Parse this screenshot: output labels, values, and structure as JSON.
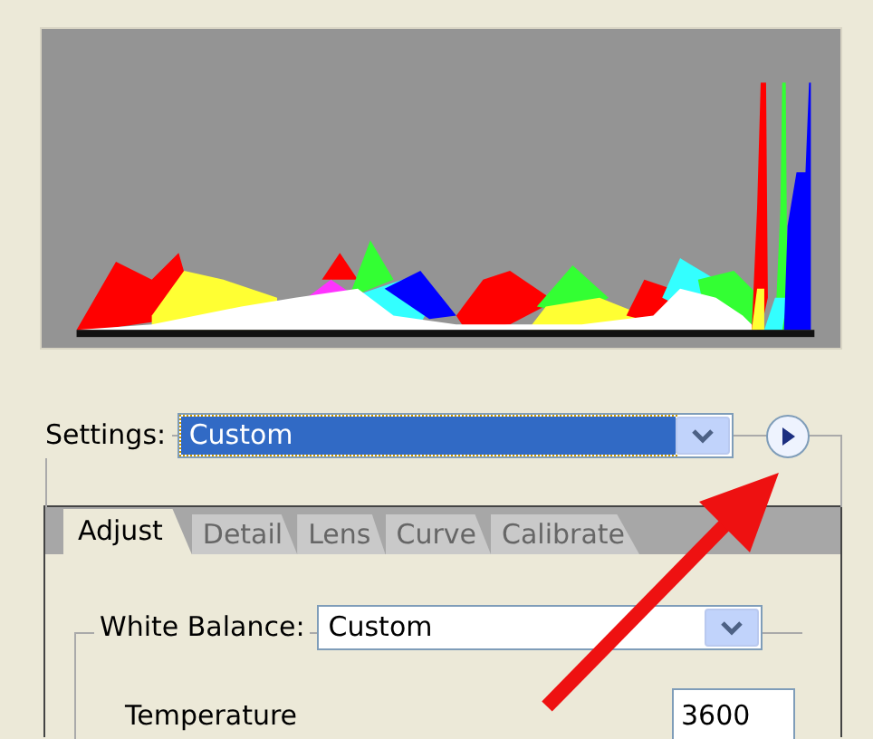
{
  "settings": {
    "label": "Settings:",
    "value": "Custom",
    "focused": true
  },
  "tabs": [
    {
      "label": "Adjust",
      "selected": true
    },
    {
      "label": "Detail",
      "selected": false
    },
    {
      "label": "Lens",
      "selected": false
    },
    {
      "label": "Curve",
      "selected": false
    },
    {
      "label": "Calibrate",
      "selected": false
    }
  ],
  "white_balance": {
    "label": "White Balance:",
    "value": "Custom"
  },
  "temperature": {
    "label": "Temperature",
    "value": "3600"
  }
}
